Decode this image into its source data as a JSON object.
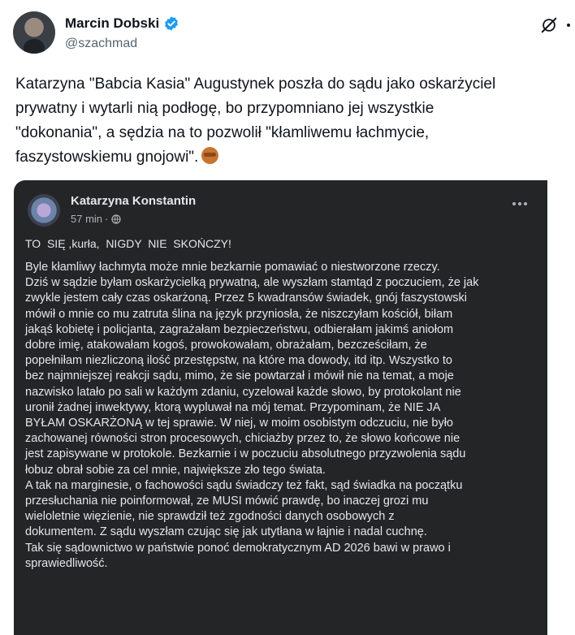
{
  "tweet": {
    "author_name": "Marcin Dobski",
    "author_handle": "@szachmad",
    "verified_color": "#1d9bf0",
    "text": "Katarzyna \"Babcia Kasia\" Augustynek poszła do sądu jako oskarżyciel\nprywatny i wytarli nią podłogę, bo przypomniano jej wszystkie\n\"dokonania\", a sędzia na to pozwolił \"kłamliwemu łachmycie,\nfaszystowskiemu gnojowi\".",
    "emoji": "see-no-evil-monkey"
  },
  "embedded_post": {
    "background": "#242526",
    "author_name": "Katarzyna Konstantin",
    "time": "57 min",
    "separator": "·",
    "headline": "TO  SIĘ ,kurła,  NIGDY  NIE  SKOŃCZY!",
    "body": "Byle kłamliwy łachmyta może mnie bezkarnie pomawiać o niestworzone rzeczy.\nDziś w sądzie byłam oskarżycielką prywatną, ale wyszłam stamtąd z poczuciem, że jak\nzwykle jestem cały czas oskarżoną. Przez 5 kwadransów świadek, gnój faszystowski\nmówił o mnie co mu zatruta ślina na język przyniosła, że niszczyłam kościół, biłam\njakąś kobietę i policjanta, zagrażałam bezpieczeństwu, odbierałam jakimś aniołom\ndobre imię, atakowałam kogoś, prowokowałam, obrażałam, bezcześciłam, że\npopełniłam niezliczoną ilość przestępstw, na które ma dowody, itd itp. Wszystko to\nbez najmniejszej reakcji sądu,  mimo, że sie powtarzał i mówił nie na temat, a moje\nnazwisko latało po sali w każdym zdaniu, cyzelował każde słowo, by protokolant nie\nuronił żadnej inwektywy, ktorą wypluwał na mój temat. Przypominam, że NIE JA\nBYŁAM OSKARŻONĄ w tej sprawie. W niej, w moim osobistym odczuciu, nie było\nzachowanej równości stron procesowych, chiciażby przez to, że słowo końcowe nie\njest zapisywane w protokole. Bezkarnie i w poczuciu absolutnego przyzwolenia sądu\nłobuz obrał sobie za cel mnie, największe zło tego świata.\nA tak na marginesie, o fachowości sądu świadczy też fakt,  sąd świadka na początku\nprzesłuchania nie poinformował, ze MUSI mówić prawdę, bo inaczej grozi mu\nwieloletnie więzienie, nie sprawdził też zgodności danych osobowych z\ndokumentem. Z sądu wyszłam czując się jak utytłana w łajnie i nadal cuchnę.\nTak się sądownictwo w państwie ponoć demokratycznym  AD 2026 bawi w prawo i\nsprawiedliwość."
  }
}
